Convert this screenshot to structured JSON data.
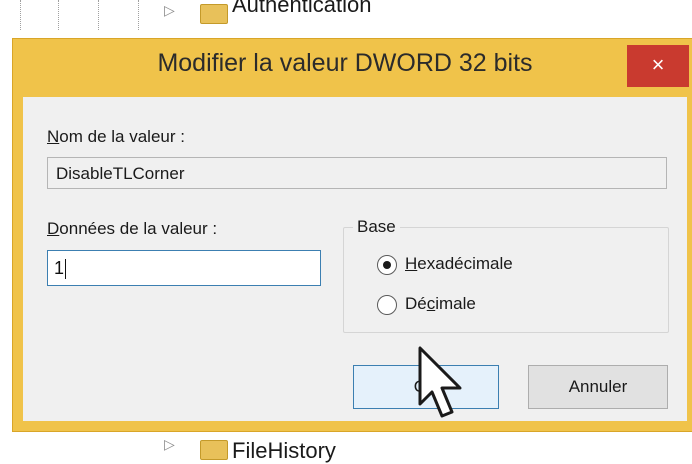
{
  "background": {
    "top_node_label": "Authentication",
    "bottom_node_label": "FileHistory"
  },
  "dialog": {
    "title": "Modifier la valeur DWORD 32 bits",
    "close_glyph": "×",
    "value_name": {
      "label_prefix": "N",
      "label_rest": "om de la valeur :",
      "value": "DisableTLCorner"
    },
    "value_data": {
      "label_prefix": "D",
      "label_rest": "onnées de la valeur :",
      "value": "1"
    },
    "base": {
      "label": "Base",
      "options": [
        {
          "prefix": "",
          "accel": "H",
          "rest": "exadécimale",
          "checked": true
        },
        {
          "prefix": "Dé",
          "accel": "c",
          "rest": "imale",
          "checked": false
        }
      ]
    },
    "ok_label": "OK",
    "cancel_label": "Annuler"
  },
  "colors": {
    "title_bar": "#f0c34a",
    "close_button": "#c93a2f",
    "ok_border": "#3c7fb1"
  }
}
